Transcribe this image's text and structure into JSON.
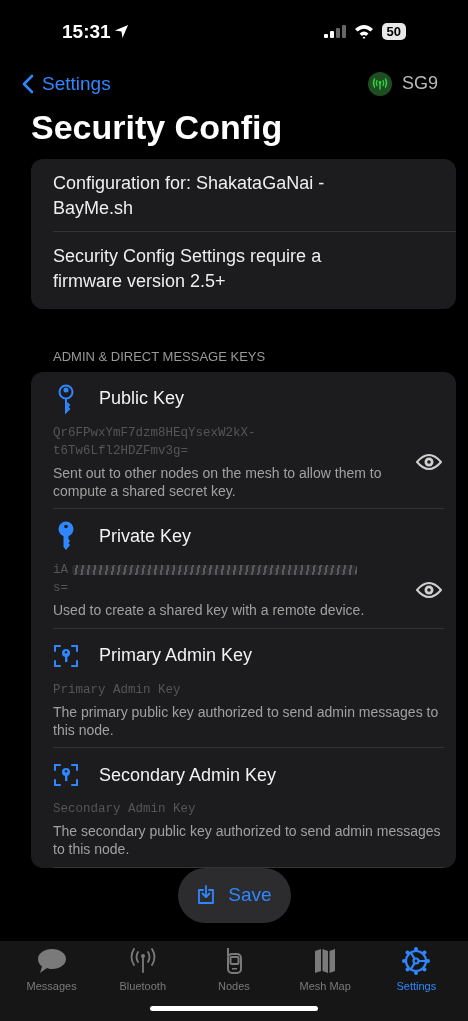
{
  "status_bar": {
    "time": "15:31",
    "battery": "50"
  },
  "nav": {
    "back": "Settings",
    "device": "SG9",
    "connected": true
  },
  "title": "Security Config",
  "info": [
    "Configuration for: ShakataGaNai - BayMe.sh",
    "Security Config Settings require a firmware version 2.5+"
  ],
  "section_header": "ADMIN & DIRECT MESSAGE KEYS",
  "keys": [
    {
      "kind": "outline",
      "label": "Public Key",
      "value": "Qr6FPwxYmF7dzm8HEqYsexW2kX-t6Tw6Lfl2HDZFmv3g=",
      "revealable": true,
      "description": "Sent out to other nodes on the mesh to allow them to compute a shared secret key."
    },
    {
      "kind": "filled",
      "label": "Private Key",
      "value": "iA",
      "value_tail": "s=",
      "redacted": true,
      "revealable": true,
      "description": "Used to create a shared key with a remote device."
    },
    {
      "kind": "framed",
      "label": "Primary Admin Key",
      "placeholder": "Primary Admin Key",
      "revealable": false,
      "description": "The primary public key authorized to send admin messages to this node."
    },
    {
      "kind": "framed",
      "label": "Secondary Admin Key",
      "placeholder": "Secondary Admin Key",
      "revealable": false,
      "description": "The secondary public key authorized to send admin messages to this node."
    }
  ],
  "save_button": "Save",
  "tabs": [
    {
      "kind": "messages",
      "label": "Messages",
      "selected": false
    },
    {
      "kind": "bluetooth",
      "label": "Bluetooth",
      "selected": false
    },
    {
      "kind": "nodes",
      "label": "Nodes",
      "selected": false
    },
    {
      "kind": "map",
      "label": "Mesh Map",
      "selected": false
    },
    {
      "kind": "settings",
      "label": "Settings",
      "selected": true
    }
  ]
}
